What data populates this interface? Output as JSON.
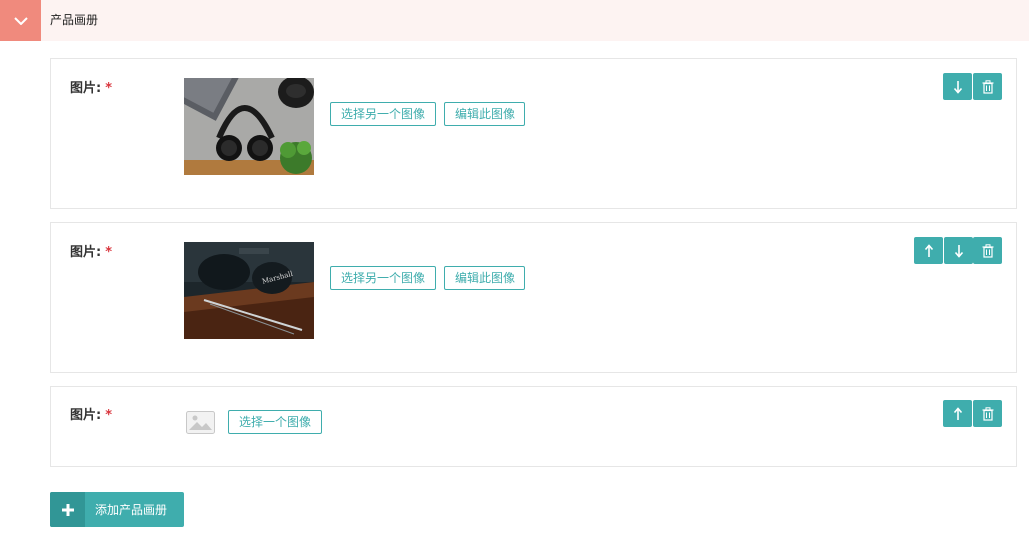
{
  "section": {
    "title": "产品画册",
    "toggle_icon": "chevron-down-icon",
    "accent_color": "#f08a7d",
    "header_bg": "#fdf3f2"
  },
  "theme": {
    "primary": "#3fadad",
    "primary_dark": "#319696",
    "required": "#d9363e"
  },
  "items": [
    {
      "label": "图片:",
      "required_mark": "*",
      "image": "headphones-on-desk-photo",
      "buttons": {
        "replace": "选择另一个图像",
        "edit": "编辑此图像"
      },
      "actions": [
        "move-down-icon",
        "delete-icon"
      ]
    },
    {
      "label": "图片:",
      "required_mark": "*",
      "image": "marshall-headphones-photo",
      "buttons": {
        "replace": "选择另一个图像",
        "edit": "编辑此图像"
      },
      "actions": [
        "move-up-icon",
        "move-down-icon",
        "delete-icon"
      ]
    },
    {
      "label": "图片:",
      "required_mark": "*",
      "image": "image-placeholder-icon",
      "buttons": {
        "select": "选择一个图像"
      },
      "actions": [
        "move-up-icon",
        "delete-icon"
      ]
    }
  ],
  "add_button": {
    "label": "添加产品画册",
    "icon": "plus-icon"
  }
}
